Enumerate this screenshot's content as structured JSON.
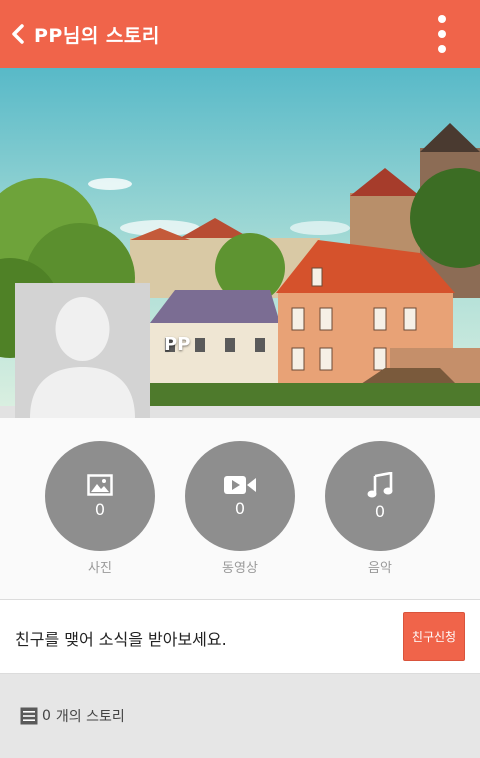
{
  "app_bar": {
    "title": "PP님의 스토리"
  },
  "profile": {
    "name": "PP"
  },
  "media": [
    {
      "label": "사진",
      "count": "0",
      "icon": "image-icon"
    },
    {
      "label": "동영상",
      "count": "0",
      "icon": "video-icon"
    },
    {
      "label": "음악",
      "count": "0",
      "icon": "music-note-icon"
    }
  ],
  "friend": {
    "message": "친구를 맺어 소식을 받아보세요.",
    "button_label": "친구신청"
  },
  "stories": {
    "count": "0",
    "suffix": "개의 스토리"
  },
  "colors": {
    "accent": "#f0644a",
    "circle": "#8e8e8e"
  }
}
